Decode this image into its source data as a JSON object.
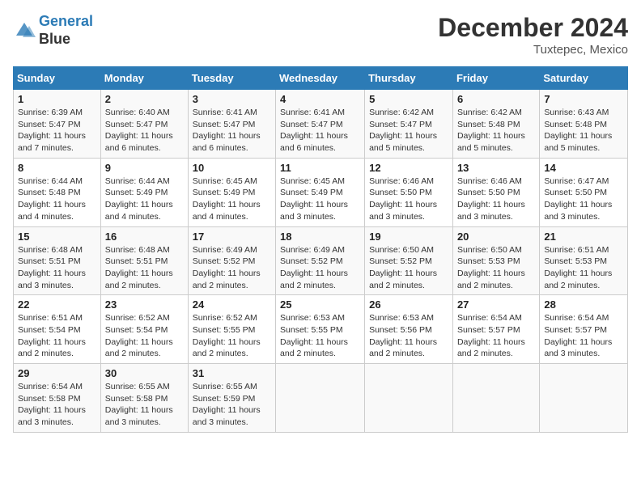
{
  "header": {
    "logo_line1": "General",
    "logo_line2": "Blue",
    "month": "December 2024",
    "location": "Tuxtepec, Mexico"
  },
  "weekdays": [
    "Sunday",
    "Monday",
    "Tuesday",
    "Wednesday",
    "Thursday",
    "Friday",
    "Saturday"
  ],
  "weeks": [
    [
      {
        "day": "1",
        "sunrise": "6:39 AM",
        "sunset": "5:47 PM",
        "daylight": "11 hours and 7 minutes."
      },
      {
        "day": "2",
        "sunrise": "6:40 AM",
        "sunset": "5:47 PM",
        "daylight": "11 hours and 6 minutes."
      },
      {
        "day": "3",
        "sunrise": "6:41 AM",
        "sunset": "5:47 PM",
        "daylight": "11 hours and 6 minutes."
      },
      {
        "day": "4",
        "sunrise": "6:41 AM",
        "sunset": "5:47 PM",
        "daylight": "11 hours and 6 minutes."
      },
      {
        "day": "5",
        "sunrise": "6:42 AM",
        "sunset": "5:47 PM",
        "daylight": "11 hours and 5 minutes."
      },
      {
        "day": "6",
        "sunrise": "6:42 AM",
        "sunset": "5:48 PM",
        "daylight": "11 hours and 5 minutes."
      },
      {
        "day": "7",
        "sunrise": "6:43 AM",
        "sunset": "5:48 PM",
        "daylight": "11 hours and 5 minutes."
      }
    ],
    [
      {
        "day": "8",
        "sunrise": "6:44 AM",
        "sunset": "5:48 PM",
        "daylight": "11 hours and 4 minutes."
      },
      {
        "day": "9",
        "sunrise": "6:44 AM",
        "sunset": "5:49 PM",
        "daylight": "11 hours and 4 minutes."
      },
      {
        "day": "10",
        "sunrise": "6:45 AM",
        "sunset": "5:49 PM",
        "daylight": "11 hours and 4 minutes."
      },
      {
        "day": "11",
        "sunrise": "6:45 AM",
        "sunset": "5:49 PM",
        "daylight": "11 hours and 3 minutes."
      },
      {
        "day": "12",
        "sunrise": "6:46 AM",
        "sunset": "5:50 PM",
        "daylight": "11 hours and 3 minutes."
      },
      {
        "day": "13",
        "sunrise": "6:46 AM",
        "sunset": "5:50 PM",
        "daylight": "11 hours and 3 minutes."
      },
      {
        "day": "14",
        "sunrise": "6:47 AM",
        "sunset": "5:50 PM",
        "daylight": "11 hours and 3 minutes."
      }
    ],
    [
      {
        "day": "15",
        "sunrise": "6:48 AM",
        "sunset": "5:51 PM",
        "daylight": "11 hours and 3 minutes."
      },
      {
        "day": "16",
        "sunrise": "6:48 AM",
        "sunset": "5:51 PM",
        "daylight": "11 hours and 2 minutes."
      },
      {
        "day": "17",
        "sunrise": "6:49 AM",
        "sunset": "5:52 PM",
        "daylight": "11 hours and 2 minutes."
      },
      {
        "day": "18",
        "sunrise": "6:49 AM",
        "sunset": "5:52 PM",
        "daylight": "11 hours and 2 minutes."
      },
      {
        "day": "19",
        "sunrise": "6:50 AM",
        "sunset": "5:52 PM",
        "daylight": "11 hours and 2 minutes."
      },
      {
        "day": "20",
        "sunrise": "6:50 AM",
        "sunset": "5:53 PM",
        "daylight": "11 hours and 2 minutes."
      },
      {
        "day": "21",
        "sunrise": "6:51 AM",
        "sunset": "5:53 PM",
        "daylight": "11 hours and 2 minutes."
      }
    ],
    [
      {
        "day": "22",
        "sunrise": "6:51 AM",
        "sunset": "5:54 PM",
        "daylight": "11 hours and 2 minutes."
      },
      {
        "day": "23",
        "sunrise": "6:52 AM",
        "sunset": "5:54 PM",
        "daylight": "11 hours and 2 minutes."
      },
      {
        "day": "24",
        "sunrise": "6:52 AM",
        "sunset": "5:55 PM",
        "daylight": "11 hours and 2 minutes."
      },
      {
        "day": "25",
        "sunrise": "6:53 AM",
        "sunset": "5:55 PM",
        "daylight": "11 hours and 2 minutes."
      },
      {
        "day": "26",
        "sunrise": "6:53 AM",
        "sunset": "5:56 PM",
        "daylight": "11 hours and 2 minutes."
      },
      {
        "day": "27",
        "sunrise": "6:54 AM",
        "sunset": "5:57 PM",
        "daylight": "11 hours and 2 minutes."
      },
      {
        "day": "28",
        "sunrise": "6:54 AM",
        "sunset": "5:57 PM",
        "daylight": "11 hours and 3 minutes."
      }
    ],
    [
      {
        "day": "29",
        "sunrise": "6:54 AM",
        "sunset": "5:58 PM",
        "daylight": "11 hours and 3 minutes."
      },
      {
        "day": "30",
        "sunrise": "6:55 AM",
        "sunset": "5:58 PM",
        "daylight": "11 hours and 3 minutes."
      },
      {
        "day": "31",
        "sunrise": "6:55 AM",
        "sunset": "5:59 PM",
        "daylight": "11 hours and 3 minutes."
      },
      null,
      null,
      null,
      null
    ]
  ]
}
